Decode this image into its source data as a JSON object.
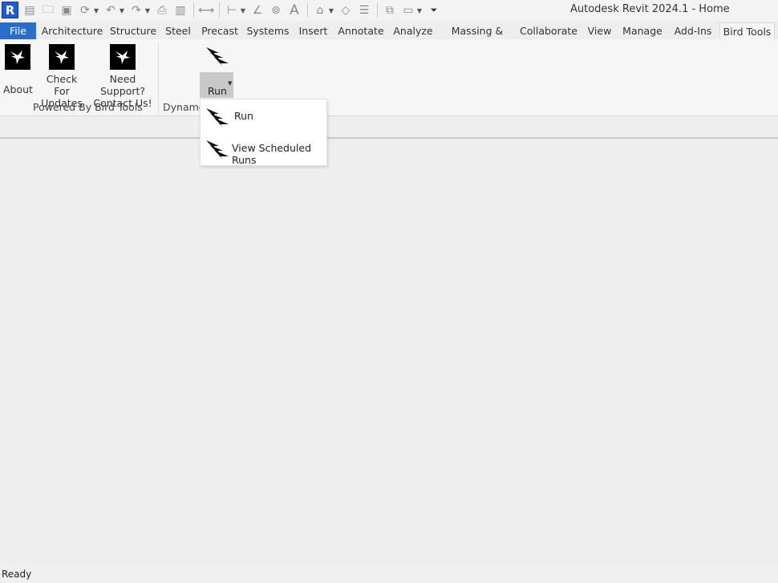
{
  "app": {
    "title": "Autodesk Revit 2024.1 - Home",
    "logo_letter": "R"
  },
  "quick_access": [
    "open-icon",
    "save-icon",
    "sync-icon",
    "undo-icon",
    "redo-icon",
    "print-icon",
    "measure-icon",
    "aligned-dimension-icon",
    "tag-icon",
    "text-icon",
    "default-3d-view-icon",
    "section-icon",
    "thin-lines-icon",
    "close-inactive-views-icon",
    "switch-windows-icon",
    "customize-qat-icon"
  ],
  "tabs": [
    "File",
    "Architecture",
    "Structure",
    "Steel",
    "Precast",
    "Systems",
    "Insert",
    "Annotate",
    "Analyze",
    "Massing & Site",
    "Collaborate",
    "View",
    "Manage",
    "Add-Ins",
    "Bird Tools"
  ],
  "active_tab": "Bird Tools",
  "ribbon": {
    "about": "About",
    "check_updates": [
      "Check",
      "For Updates"
    ],
    "support": [
      "Need Support?",
      "Contact Us!"
    ],
    "panel_bird_tools": "Powered By Bird Tools",
    "panel_dynamo": "Dynamo",
    "run_label": "Run"
  },
  "dropdown": {
    "items": [
      "Run",
      "View Scheduled Runs"
    ]
  },
  "status": {
    "text": "Ready"
  }
}
